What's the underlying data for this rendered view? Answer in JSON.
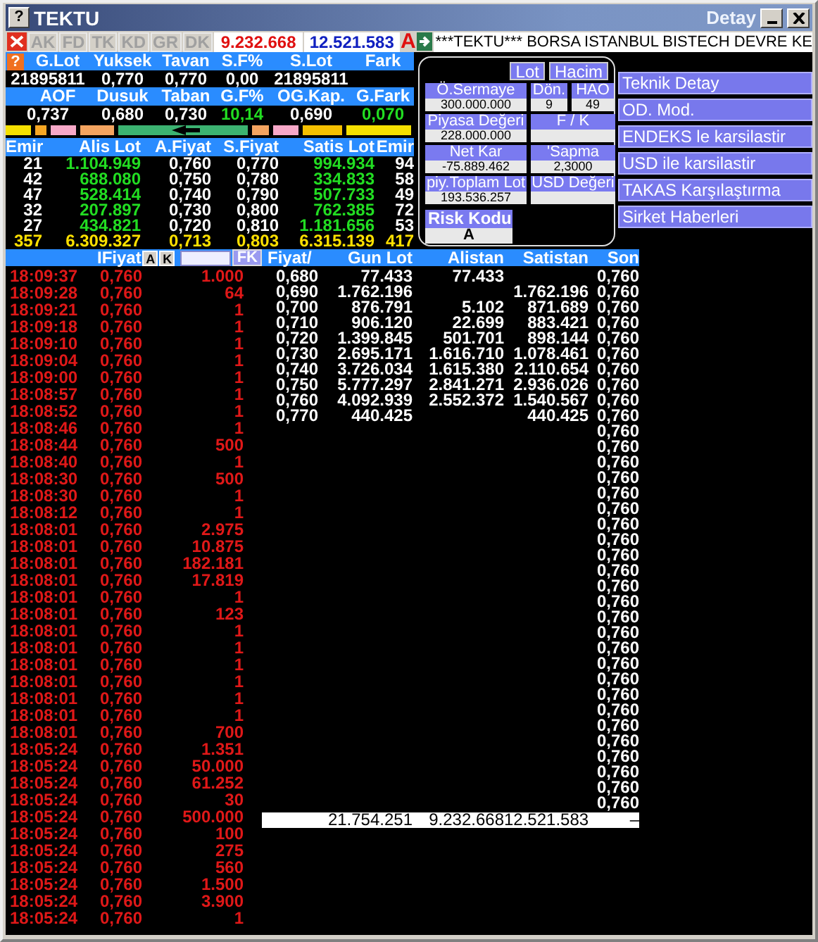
{
  "window": {
    "help": "?",
    "title": "TEKTU",
    "subtitle": "Detay"
  },
  "toolbar": {
    "tabs": [
      {
        "label": "AK",
        "disabled": true
      },
      {
        "label": "FD",
        "disabled": true
      },
      {
        "label": "TK",
        "disabled": true
      },
      {
        "label": "KD",
        "disabled": true
      },
      {
        "label": "GR",
        "disabled": true
      },
      {
        "label": "DK",
        "disabled": true
      }
    ],
    "buy_volume": "9.232.668",
    "sell_volume": "12.521.583",
    "flag": "A",
    "ticker": "***TEKTU*** BORSA ISTANBUL BISTECH DEVRE KE"
  },
  "summary": {
    "help": "?",
    "blocks": [
      [
        {
          "label": "G.Lot",
          "value": "21895811",
          "positive": false
        },
        {
          "label": "Yuksek",
          "value": "0,770",
          "positive": false
        },
        {
          "label": "Tavan",
          "value": "0,770",
          "positive": false
        },
        {
          "label": "S.F%",
          "value": "0,00",
          "positive": false
        },
        {
          "label": "S.Lot",
          "value": "21895811",
          "positive": false
        },
        {
          "label": "Fark"
        }
      ],
      [
        {
          "label": "AOF",
          "value": "0,737",
          "positive": false
        },
        {
          "label": "Dusuk",
          "value": "0,680",
          "positive": false
        },
        {
          "label": "Taban",
          "value": "0,730",
          "positive": false
        },
        {
          "label": "G.F%",
          "value": "10,14",
          "positive": true
        },
        {
          "label": "OG.Kap.",
          "value": "0,690",
          "positive": false
        },
        {
          "label": "G.Fark",
          "value": "0,070",
          "positive": true
        }
      ]
    ]
  },
  "order_book": {
    "columns": [
      "Emir",
      "Alis Lot",
      "A.Fiyat",
      "S.Fiyat",
      "Satis Lot",
      "Emir"
    ],
    "rows": [
      [
        "21",
        "1.104.949",
        "0,760",
        "0,770",
        "994.934",
        "94"
      ],
      [
        "42",
        "688.080",
        "0,750",
        "0,780",
        "334.833",
        "58"
      ],
      [
        "47",
        "528.414",
        "0,740",
        "0,790",
        "507.733",
        "49"
      ],
      [
        "32",
        "207.897",
        "0,730",
        "0,800",
        "762.385",
        "72"
      ],
      [
        "27",
        "434.821",
        "0,720",
        "0,810",
        "1.181.656",
        "53"
      ]
    ],
    "totals": [
      "357",
      "6.309.327",
      "0,713",
      "0,803",
      "6.315.139",
      "417"
    ]
  },
  "detail": {
    "toggles": [
      "Lot",
      "Hacim"
    ],
    "rows": [
      [
        {
          "label": "Ö.Sermaye",
          "value": "300.000.000"
        },
        {
          "label": "Dön.",
          "value": "9"
        },
        {
          "label": "HAO",
          "value": "49"
        }
      ],
      [
        {
          "label": "Piyasa Değeri",
          "value": "228.000.000"
        },
        {
          "label": "F / K"
        }
      ],
      [
        {
          "label": "Net Kar",
          "value": "-75.889.462"
        },
        {
          "label": "'Sapma",
          "value": "2,3000"
        }
      ],
      [
        {
          "label": "piy.Toplam Lot",
          "value": "193.536.257"
        },
        {
          "label": "USD Değeri"
        }
      ]
    ],
    "risk": {
      "label": "Risk Kodu",
      "value": "A"
    }
  },
  "menu": [
    "Teknik Detay",
    "OD. Mod.",
    "ENDEKS le karsilastir",
    "USD ile karsilastir",
    "TAKAS Karşılaştırma",
    "Sirket Haberleri"
  ],
  "trades": {
    "header": "IFiyat",
    "buttons": [
      "A",
      "K"
    ],
    "filter_button": "FK",
    "rows": [
      [
        "18:09:37",
        "0,760",
        "1.000"
      ],
      [
        "18:09:28",
        "0,760",
        "64"
      ],
      [
        "18:09:21",
        "0,760",
        "1"
      ],
      [
        "18:09:18",
        "0,760",
        "1"
      ],
      [
        "18:09:10",
        "0,760",
        "1"
      ],
      [
        "18:09:04",
        "0,760",
        "1"
      ],
      [
        "18:09:00",
        "0,760",
        "1"
      ],
      [
        "18:08:57",
        "0,760",
        "1"
      ],
      [
        "18:08:52",
        "0,760",
        "1"
      ],
      [
        "18:08:46",
        "0,760",
        "1"
      ],
      [
        "18:08:44",
        "0,760",
        "500"
      ],
      [
        "18:08:40",
        "0,760",
        "1"
      ],
      [
        "18:08:30",
        "0,760",
        "500"
      ],
      [
        "18:08:30",
        "0,760",
        "1"
      ],
      [
        "18:08:12",
        "0,760",
        "1"
      ],
      [
        "18:08:01",
        "0,760",
        "2.975"
      ],
      [
        "18:08:01",
        "0,760",
        "10.875"
      ],
      [
        "18:08:01",
        "0,760",
        "182.181"
      ],
      [
        "18:08:01",
        "0,760",
        "17.819"
      ],
      [
        "18:08:01",
        "0,760",
        "1"
      ],
      [
        "18:08:01",
        "0,760",
        "123"
      ],
      [
        "18:08:01",
        "0,760",
        "1"
      ],
      [
        "18:08:01",
        "0,760",
        "1"
      ],
      [
        "18:08:01",
        "0,760",
        "1"
      ],
      [
        "18:08:01",
        "0,760",
        "1"
      ],
      [
        "18:08:01",
        "0,760",
        "1"
      ],
      [
        "18:08:01",
        "0,760",
        "1"
      ],
      [
        "18:08:01",
        "0,760",
        "700"
      ],
      [
        "18:05:24",
        "0,760",
        "1.351"
      ],
      [
        "18:05:24",
        "0,760",
        "50.000"
      ],
      [
        "18:05:24",
        "0,760",
        "61.252"
      ],
      [
        "18:05:24",
        "0,760",
        "30"
      ],
      [
        "18:05:24",
        "0,760",
        "500.000"
      ],
      [
        "18:05:24",
        "0,760",
        "100"
      ],
      [
        "18:05:24",
        "0,760",
        "275"
      ],
      [
        "18:05:24",
        "0,760",
        "560"
      ],
      [
        "18:05:24",
        "0,760",
        "1.500"
      ],
      [
        "18:05:24",
        "0,760",
        "3.900"
      ],
      [
        "18:05:24",
        "0,760",
        "1"
      ]
    ]
  },
  "price_table": {
    "columns": [
      "Fiyat/",
      "Gun Lot",
      "Alistan",
      "Satistan",
      "Son"
    ],
    "rows": [
      {
        "price": "0,680",
        "volume": "77.433",
        "bought": "77.433",
        "last": "0,760"
      },
      {
        "price": "0,690",
        "volume": "1.762.196",
        "sold": "1.762.196",
        "last": "0,760"
      },
      {
        "price": "0,700",
        "volume": "876.791",
        "bought": "5.102",
        "sold": "871.689",
        "last": "0,760"
      },
      {
        "price": "0,710",
        "volume": "906.120",
        "bought": "22.699",
        "sold": "883.421",
        "last": "0,760"
      },
      {
        "price": "0,720",
        "volume": "1.399.845",
        "bought": "501.701",
        "sold": "898.144",
        "last": "0,760"
      },
      {
        "price": "0,730",
        "volume": "2.695.171",
        "bought": "1.616.710",
        "sold": "1.078.461",
        "last": "0,760"
      },
      {
        "price": "0,740",
        "volume": "3.726.034",
        "bought": "1.615.380",
        "sold": "2.110.654",
        "last": "0,760"
      },
      {
        "price": "0,750",
        "volume": "5.777.297",
        "bought": "2.841.271",
        "sold": "2.936.026",
        "last": "0,760"
      },
      {
        "price": "0,760",
        "volume": "4.092.939",
        "bought": "2.552.372",
        "sold": "1.540.567",
        "last": "0,760"
      },
      {
        "price": "0,770",
        "volume": "440.425",
        "sold": "440.425",
        "last": "0,760"
      },
      {
        "last": "0,760"
      },
      {
        "last": "0,760"
      },
      {
        "last": "0,760"
      },
      {
        "last": "0,760"
      },
      {
        "last": "0,760"
      },
      {
        "last": "0,760"
      },
      {
        "last": "0,760"
      },
      {
        "last": "0,760"
      },
      {
        "last": "0,760"
      },
      {
        "last": "0,760"
      },
      {
        "last": "0,760"
      },
      {
        "last": "0,760"
      },
      {
        "last": "0,760"
      },
      {
        "last": "0,760"
      },
      {
        "last": "0,760"
      },
      {
        "last": "0,760"
      },
      {
        "last": "0,760"
      },
      {
        "last": "0,760"
      },
      {
        "last": "0,760"
      },
      {
        "last": "0,760"
      },
      {
        "last": "0,760"
      },
      {
        "last": "0,760"
      },
      {
        "last": "0,760"
      },
      {
        "last": "0,760"
      },
      {
        "last": "0,760"
      }
    ],
    "totals": {
      "volume": "21.754.251",
      "bought": "9.232.668",
      "sold": "12.521.583",
      "last": "–"
    }
  }
}
